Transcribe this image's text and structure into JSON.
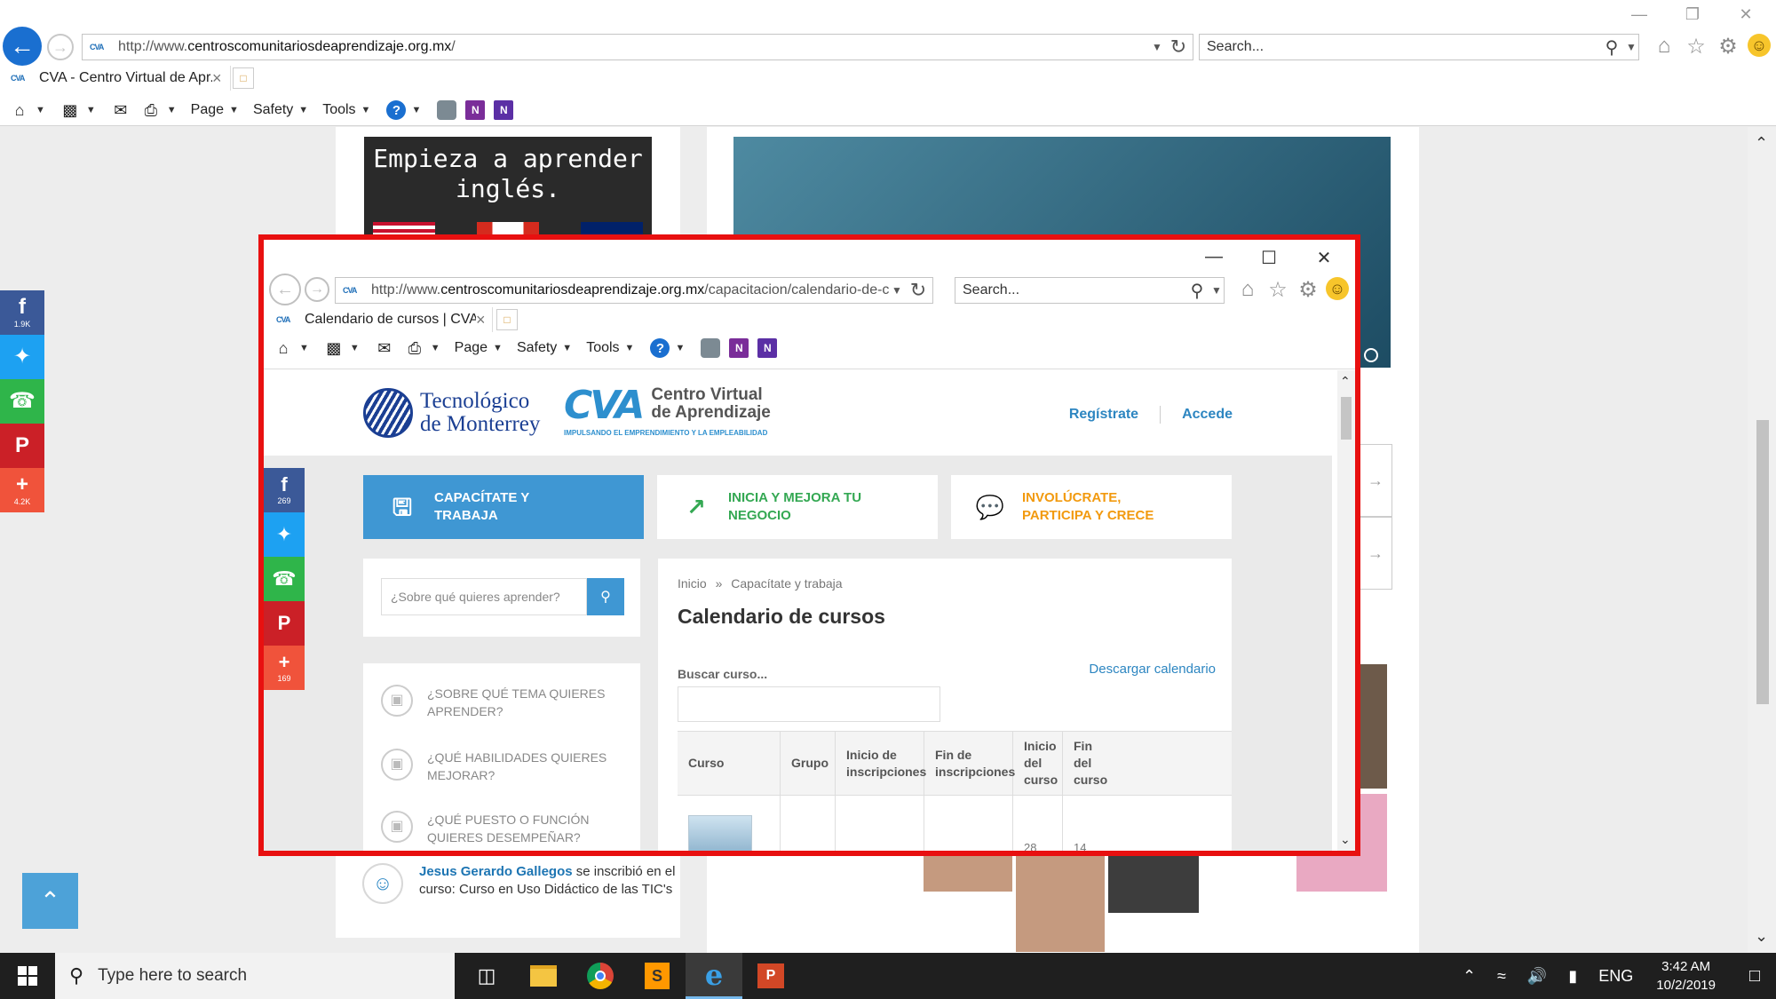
{
  "outer_browser": {
    "url_prefix": "http://www.",
    "url_host": "centroscomunitariosdeaprendizaje.org.mx",
    "url_suffix": "/",
    "search_placeholder": "Search...",
    "tab_title": "CVA - Centro Virtual de Apr...",
    "menu": {
      "page": "Page",
      "safety": "Safety",
      "tools": "Tools"
    }
  },
  "outer_page": {
    "promo_text": "Empieza a aprender inglés.",
    "activity": {
      "name": "Jesus Gerardo Gallegos",
      "text": " se inscribió en el curso: Curso en Uso Didáctico de las TIC's"
    },
    "share_counts": {
      "facebook": "1.9K",
      "plus": "4.2K"
    }
  },
  "inner_browser": {
    "url_prefix": "http://www.",
    "url_host": "centroscomunitariosdeaprendizaje.org.mx",
    "url_suffix": "/capacitacion/calendario-de-c",
    "search_placeholder": "Search...",
    "tab_title": "Calendario de cursos | CVA ...",
    "menu": {
      "page": "Page",
      "safety": "Safety",
      "tools": "Tools"
    }
  },
  "site": {
    "tec_logo_line1": "Tecnológico",
    "tec_logo_line2": "de Monterrey",
    "cva_mark": "CVA",
    "cva_line1": "Centro Virtual",
    "cva_line2": "de Aprendizaje",
    "cva_tagline": "IMPULSANDO EL EMPRENDIMIENTO Y LA EMPLEABILIDAD",
    "register": "Regístrate",
    "login": "Accede",
    "share_counts": {
      "facebook": "269",
      "plus": "169"
    },
    "nav": [
      {
        "line1": "CAPACÍTATE Y",
        "line2": "TRABAJA"
      },
      {
        "line1": "INICIA Y MEJORA TU",
        "line2": "NEGOCIO"
      },
      {
        "line1": "INVOLÚCRATE,",
        "line2": "PARTICIPA Y CRECE"
      }
    ],
    "search_placeholder": "¿Sobre qué quieres aprender?",
    "topics": [
      {
        "line1": "¿SOBRE QUÉ TEMA QUIERES",
        "line2": "APRENDER?"
      },
      {
        "line1": "¿QUÉ HABILIDADES QUIERES",
        "line2": "MEJORAR?"
      },
      {
        "line1": "¿QUÉ PUESTO O FUNCIÓN",
        "line2": "QUIERES DESEMPEÑAR?"
      }
    ],
    "breadcrumb": {
      "home": "Inicio",
      "sep": "»",
      "current": "Capacítate y trabaja"
    },
    "page_title": "Calendario de cursos",
    "search_course_label": "Buscar curso...",
    "download_calendar": "Descargar calendario",
    "table": {
      "headers": [
        {
          "l1": "Curso",
          "l2": "",
          "l3": ""
        },
        {
          "l1": "Grupo",
          "l2": "",
          "l3": ""
        },
        {
          "l1": "Inicio de",
          "l2": "inscripciones",
          "l3": ""
        },
        {
          "l1": "Fin de",
          "l2": "inscripciones",
          "l3": ""
        },
        {
          "l1": "Inicio",
          "l2": "del",
          "l3": "curso"
        },
        {
          "l1": "Fin",
          "l2": "del",
          "l3": "curso"
        }
      ],
      "rows": [
        {
          "course": "",
          "group": "",
          "reg_start": "",
          "reg_end": "",
          "start": "28",
          "end": "14"
        }
      ]
    }
  },
  "taskbar": {
    "search_placeholder": "Type here to search",
    "lang": "ENG",
    "time": "3:42 AM",
    "date": "10/2/2019"
  },
  "colors": {
    "highlight_frame": "#e81010",
    "facebook": "#3b5998",
    "twitter": "#1da1f2",
    "whatsapp": "#2fb54a",
    "pinterest": "#cb2027",
    "plus": "#f0533b",
    "nav_active": "#3f97d3",
    "nav_business": "#34a853",
    "nav_involve": "#f29a0f",
    "link_blue": "#2d86c1"
  }
}
